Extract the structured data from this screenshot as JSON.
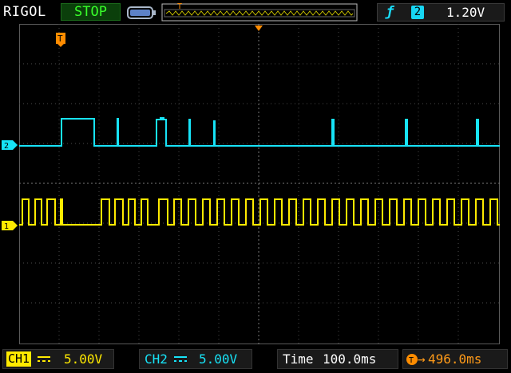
{
  "header": {
    "brand": "RIGOL",
    "run_state": "STOP",
    "trigger_source": "2",
    "trigger_level": "1.20V",
    "trigger_marker": "T"
  },
  "channels": {
    "ch1": {
      "label": "CH1",
      "scale": "5.00V",
      "marker": "1",
      "color": "#ffea00"
    },
    "ch2": {
      "label": "CH2",
      "scale": "5.00V",
      "marker": "2",
      "color": "#17e3f7"
    }
  },
  "timebase": {
    "label": "Time",
    "value": "100.0ms"
  },
  "trigger_offset": "496.0ms",
  "icons": [
    "battery-icon",
    "memory-depth-icon",
    "trigger-rising-icon",
    "dc-coupling-icon"
  ]
}
